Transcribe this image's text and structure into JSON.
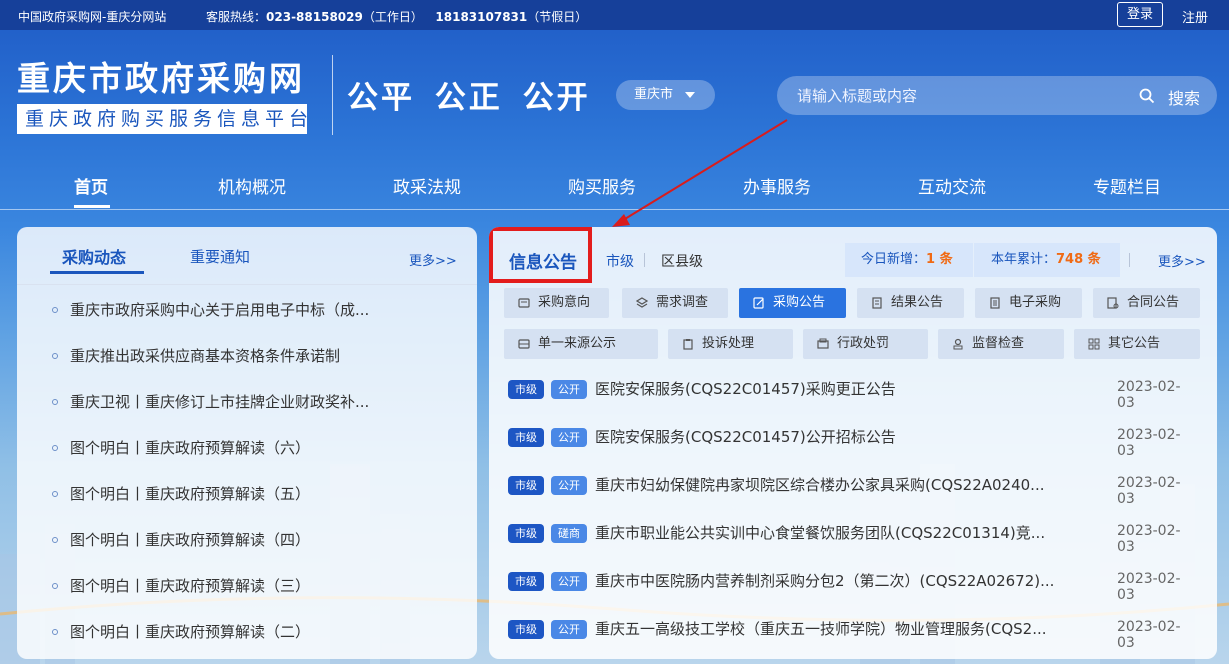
{
  "topbar": {
    "site_name": "中国政府采购网-重庆分网站",
    "hotline_label": "客服热线：",
    "hotline_number1": "023-88158029",
    "hotline_note1": "（工作日）",
    "hotline_number2": "18183107831",
    "hotline_note2": "（节假日）",
    "login": "登录",
    "register": "注册"
  },
  "header": {
    "title": "重庆市政府采购网",
    "subtitle": "重庆政府购买服务信息平台",
    "slogan": "公平 公正 公开",
    "city": "重庆市",
    "search_placeholder": "请输入标题或内容",
    "search_button": "搜索"
  },
  "nav": {
    "items": [
      "首页",
      "机构概况",
      "政采法规",
      "购买服务",
      "办事服务",
      "互动交流",
      "专题栏目"
    ]
  },
  "left": {
    "tab1": "采购动态",
    "tab2": "重要通知",
    "more": "更多>>",
    "news": [
      "重庆市政府采购中心关于启用电子中标（成...",
      "重庆推出政采供应商基本资格条件承诺制",
      "重庆卫视丨重庆修订上市挂牌企业财政奖补...",
      "图个明白丨重庆政府预算解读（六）",
      "图个明白丨重庆政府预算解读（五）",
      "图个明白丨重庆政府预算解读（四）",
      "图个明白丨重庆政府预算解读（三）",
      "图个明白丨重庆政府预算解读（二）"
    ]
  },
  "right": {
    "tab1": "信息公告",
    "tab2": "市级",
    "tab3": "区县级",
    "today_label": "今日新增：",
    "today_value": "1 条",
    "year_label": "本年累计：",
    "year_value": "748 条",
    "more": "更多>>",
    "categories_row1": [
      "采购意向",
      "需求调查",
      "采购公告",
      "结果公告",
      "电子采购",
      "合同公告"
    ],
    "categories_row2": [
      "单一来源公示",
      "投诉处理",
      "行政处罚",
      "监督检查",
      "其它公告"
    ],
    "active_category": "采购公告",
    "notices": [
      {
        "level": "市级",
        "type": "公开",
        "title": "医院安保服务(CQS22C01457)采购更正公告",
        "date": "2023-02-03"
      },
      {
        "level": "市级",
        "type": "公开",
        "title": "医院安保服务(CQS22C01457)公开招标公告",
        "date": "2023-02-03"
      },
      {
        "level": "市级",
        "type": "公开",
        "title": "重庆市妇幼保健院冉家坝院区综合楼办公家具采购(CQS22A0240...",
        "date": "2023-02-03"
      },
      {
        "level": "市级",
        "type": "磋商",
        "title": "重庆市职业能公共实训中心食堂餐饮服务团队(CQS22C01314)竞...",
        "date": "2023-02-03"
      },
      {
        "level": "市级",
        "type": "公开",
        "title": "重庆市中医院肠内营养制剂采购分包2（第二次）(CQS22A02672)...",
        "date": "2023-02-03"
      },
      {
        "level": "市级",
        "type": "公开",
        "title": "重庆五一高级技工学校（重庆五一技师学院）物业管理服务(CQS2...",
        "date": "2023-02-03"
      }
    ]
  },
  "colors": {
    "primary": "#1a56bd",
    "topbar": "#16409a",
    "highlight_box": "#e31c1c",
    "count": "#f06a14"
  }
}
